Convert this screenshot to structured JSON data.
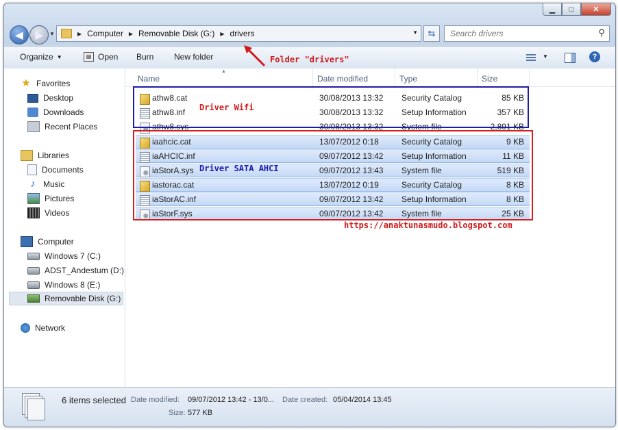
{
  "window": {
    "breadcrumbs": [
      "Computer",
      "Removable Disk (G:)",
      "drivers"
    ],
    "search_placeholder": "Search drivers"
  },
  "toolbar": {
    "organize": "Organize",
    "open": "Open",
    "burn": "Burn",
    "new_folder": "New folder"
  },
  "nav": {
    "favorites": "Favorites",
    "desktop": "Desktop",
    "downloads": "Downloads",
    "recent_places": "Recent Places",
    "libraries": "Libraries",
    "documents": "Documents",
    "music": "Music",
    "pictures": "Pictures",
    "videos": "Videos",
    "computer": "Computer",
    "win7": "Windows 7 (C:)",
    "adst": "ADST_Andestum (D:)",
    "win8": "Windows 8 (E:)",
    "removable": "Removable Disk (G:)",
    "network": "Network"
  },
  "columns": {
    "name": "Name",
    "date": "Date modified",
    "type": "Type",
    "size": "Size"
  },
  "files": [
    {
      "name": "athw8.cat",
      "date": "30/08/2013 13:32",
      "type": "Security Catalog",
      "size": "85 KB",
      "icon": "catalog-icon",
      "selected": false
    },
    {
      "name": "athw8.inf",
      "date": "30/08/2013 13:32",
      "type": "Setup Information",
      "size": "357 KB",
      "icon": "setup-info-icon",
      "selected": false
    },
    {
      "name": "athw8.sys",
      "date": "30/08/2013 13:32",
      "type": "System file",
      "size": "2,891 KB",
      "icon": "system-file-icon",
      "selected": false
    },
    {
      "name": "iaahcic.cat",
      "date": "13/07/2012 0:18",
      "type": "Security Catalog",
      "size": "9 KB",
      "icon": "catalog-icon",
      "selected": true
    },
    {
      "name": "iaAHCIC.inf",
      "date": "09/07/2012 13:42",
      "type": "Setup Information",
      "size": "11 KB",
      "icon": "setup-info-icon",
      "selected": true
    },
    {
      "name": "iaStorA.sys",
      "date": "09/07/2012 13:43",
      "type": "System file",
      "size": "519 KB",
      "icon": "system-file-icon",
      "selected": true
    },
    {
      "name": "iastorac.cat",
      "date": "13/07/2012 0:19",
      "type": "Security Catalog",
      "size": "8 KB",
      "icon": "catalog-icon",
      "selected": true
    },
    {
      "name": "iaStorAC.inf",
      "date": "09/07/2012 13:42",
      "type": "Setup Information",
      "size": "8 KB",
      "icon": "setup-info-icon",
      "selected": true
    },
    {
      "name": "iaStorF.sys",
      "date": "09/07/2012 13:42",
      "type": "System file",
      "size": "25 KB",
      "icon": "system-file-icon",
      "selected": true
    }
  ],
  "annotations": {
    "folder": "Folder \"drivers\"",
    "wifi": "Driver Wifi",
    "sata": "Driver SATA AHCI",
    "url": "https://anaktunasmudo.blogspot.com"
  },
  "details": {
    "count": "6 items selected",
    "date_modified_label": "Date modified:",
    "date_modified_value": "09/07/2012 13:42 - 13/0...",
    "date_created_label": "Date created:",
    "date_created_value": "05/04/2014 13:45",
    "size_label": "Size:",
    "size_value": "577 KB"
  },
  "colors": {
    "annotation_red": "#d11a1a",
    "annotation_blue": "#1a1ab0",
    "selection": "#c4d9f5"
  }
}
